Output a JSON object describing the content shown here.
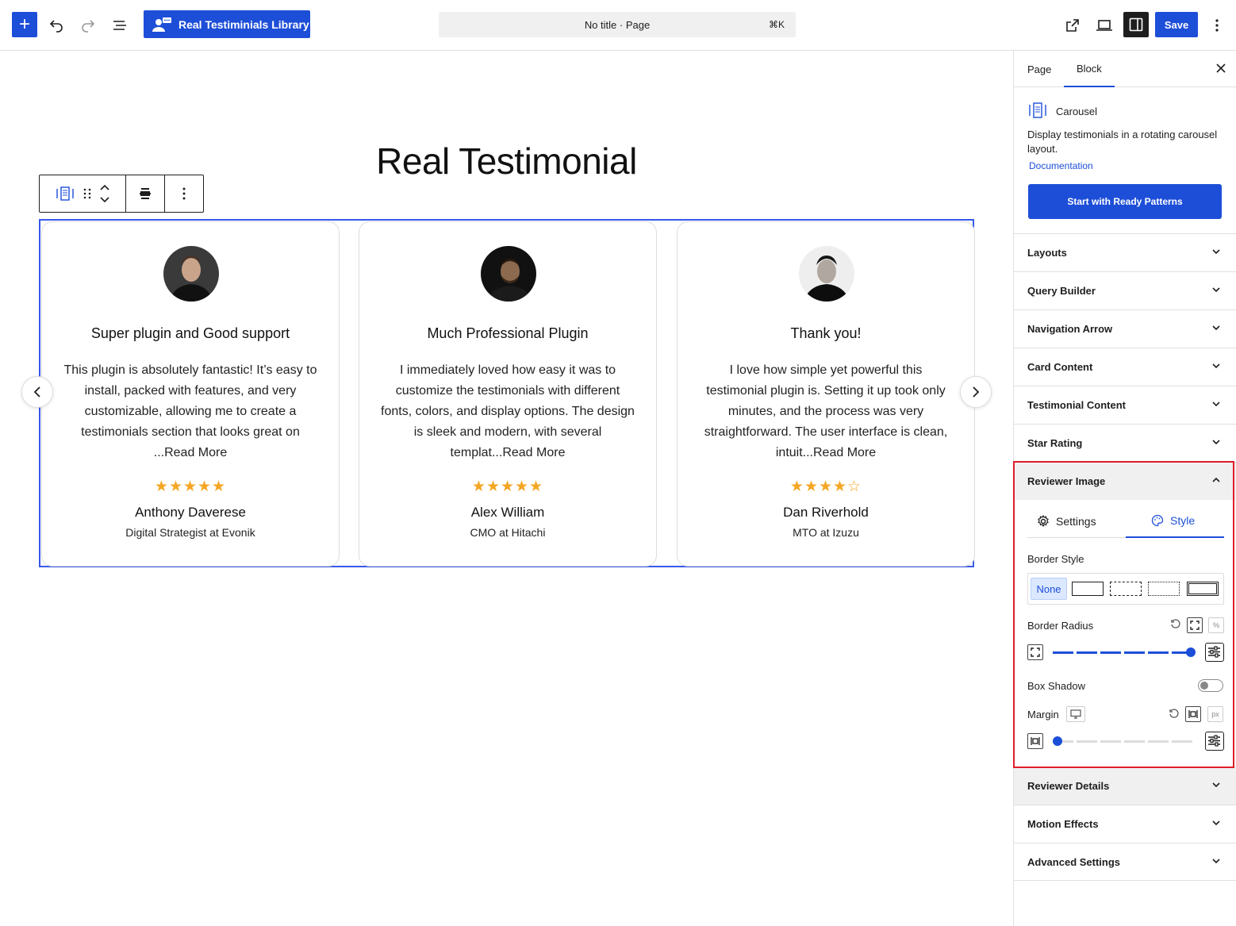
{
  "topbar": {
    "add_icon": "plus-icon",
    "library_label": "Real Testiminials Library",
    "command_title": "No title · Page",
    "command_shortcut": "⌘K",
    "save_label": "Save"
  },
  "editor": {
    "page_heading": "Real Testimonial",
    "cards": [
      {
        "title": "Super plugin and Good support",
        "body": "This plugin is absolutely fantastic! It’s easy to install, packed with features, and very customizable, allowing me to create a testimonials section that looks great on ...Read More",
        "rating": 5,
        "name": "Anthony Daverese",
        "role": "Digital Strategist at Evonik"
      },
      {
        "title": "Much Professional Plugin",
        "body": "I immediately loved how easy it was to customize the testimonials with different fonts, colors, and display options. The design is sleek and modern, with several templat...Read More",
        "rating": 5,
        "name": "Alex William",
        "role": "CMO at Hitachi"
      },
      {
        "title": "Thank you!",
        "body": "I love how simple yet powerful this testimonial plugin is. Setting it up took only minutes, and the process was very straightforward. The user interface is clean, intuit...Read More",
        "rating": 4,
        "name": "Dan Riverhold",
        "role": "MTO at Izuzu"
      }
    ]
  },
  "panel": {
    "tabs": [
      "Page",
      "Block"
    ],
    "block_name": "Carousel",
    "block_description": "Display testimonials in a rotating carousel layout.",
    "doc_link": "Documentation",
    "patterns_button": "Start with Ready Patterns",
    "sections": [
      "Layouts",
      "Query Builder",
      "Navigation Arrow",
      "Card Content",
      "Testimonial Content",
      "Star Rating"
    ],
    "open_section": "Reviewer Image",
    "sub_tabs": [
      "Settings",
      "Style"
    ],
    "border_style_label": "Border Style",
    "border_none": "None",
    "border_radius_label": "Border Radius",
    "radius_unit": "%",
    "radius_value_fraction": 1.0,
    "box_shadow_label": "Box Shadow",
    "margin_label": "Margin",
    "margin_unit": "px",
    "margin_value_fraction": 0.0,
    "after_sections": [
      "Reviewer Details",
      "Motion Effects",
      "Advanced Settings"
    ]
  },
  "colors": {
    "accent": "#1d4ed8",
    "star": "#f5a623",
    "highlight": "#e11d2a"
  }
}
